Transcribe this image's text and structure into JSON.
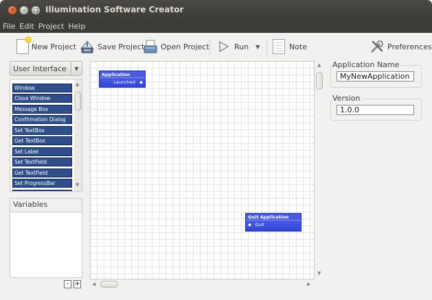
{
  "window": {
    "title": "Illumination Software Creator",
    "buttons": [
      "close",
      "minimize",
      "maximize"
    ]
  },
  "menubar": {
    "items": [
      "File",
      "Edit",
      "Project",
      "Help"
    ]
  },
  "toolbar": {
    "new_project": "New Project",
    "save_project": "Save Project",
    "open_project": "Open Project",
    "run": "Run",
    "note": "Note",
    "preferences": "Preferences",
    "icons": {
      "new_project": "new-document-icon",
      "save_project": "save-icon",
      "open_project": "open-folder-icon",
      "run": "play-icon",
      "note": "note-icon",
      "preferences": "tools-icon"
    }
  },
  "sidebar": {
    "category": "User Interface",
    "blocks": [
      "Window",
      "Close Window",
      "Message Box",
      "Confirmation Dialog",
      "Set TextBox",
      "Get TextBox",
      "Set Label",
      "Set TextField",
      "Get TextField",
      "Set ProgressBar"
    ],
    "variables_header": "Variables",
    "remove_label": "-",
    "add_label": "+"
  },
  "canvas": {
    "nodes": [
      {
        "title": "Application",
        "port": "Launched"
      },
      {
        "title": "Quit Application",
        "port": "Quit"
      }
    ],
    "colors": {
      "node_fill": "#2f45d8",
      "block_fill": "#2f4f8c"
    }
  },
  "properties": {
    "app_name_label": "Application Name",
    "app_name_value": "MyNewApplication",
    "version_label": "Version",
    "version_value": "1.0.0"
  }
}
